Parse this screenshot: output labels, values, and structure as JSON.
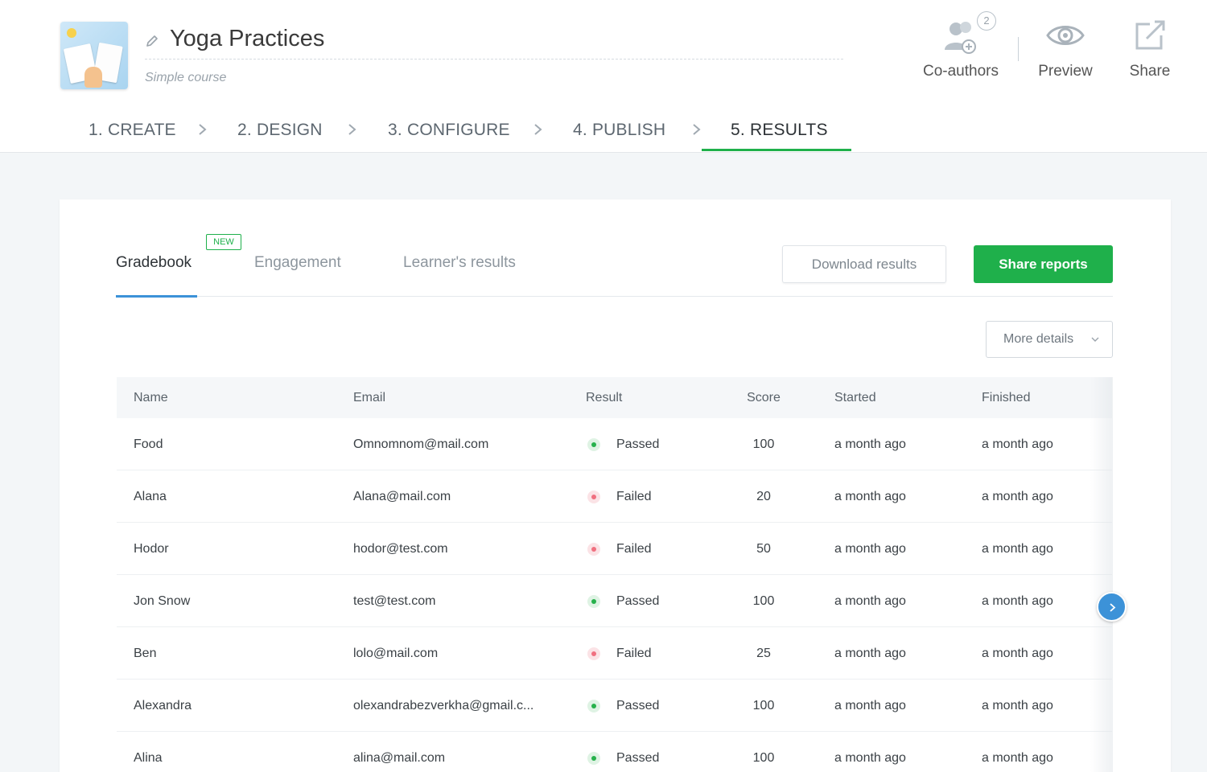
{
  "course": {
    "title": "Yoga Practices",
    "subtitle": "Simple course"
  },
  "header_actions": {
    "coauthors_label": "Co-authors",
    "coauthors_count": "2",
    "preview_label": "Preview",
    "share_label": "Share"
  },
  "steps": [
    {
      "label": "1. CREATE"
    },
    {
      "label": "2. DESIGN"
    },
    {
      "label": "3. CONFIGURE"
    },
    {
      "label": "4. PUBLISH"
    },
    {
      "label": "5. RESULTS",
      "active": true
    }
  ],
  "tabs": {
    "new_badge": "NEW",
    "items": [
      {
        "label": "Gradebook",
        "active": true
      },
      {
        "label": "Engagement"
      },
      {
        "label": "Learner's results"
      }
    ]
  },
  "buttons": {
    "download": "Download results",
    "share_reports": "Share reports",
    "more_details": "More details"
  },
  "table": {
    "columns": [
      "Name",
      "Email",
      "Result",
      "Score",
      "Started",
      "Finished"
    ],
    "rows": [
      {
        "name": "Food",
        "email": "Omnomnom@mail.com",
        "result": "Passed",
        "score": "100",
        "started": "a month ago",
        "finished": "a month ago"
      },
      {
        "name": "Alana",
        "email": "Alana@mail.com",
        "result": "Failed",
        "score": "20",
        "started": "a month ago",
        "finished": "a month ago"
      },
      {
        "name": "Hodor",
        "email": "hodor@test.com",
        "result": "Failed",
        "score": "50",
        "started": "a month ago",
        "finished": "a month ago"
      },
      {
        "name": "Jon Snow",
        "email": "test@test.com",
        "result": "Passed",
        "score": "100",
        "started": "a month ago",
        "finished": "a month ago"
      },
      {
        "name": "Ben",
        "email": "lolo@mail.com",
        "result": "Failed",
        "score": "25",
        "started": "a month ago",
        "finished": "a month ago"
      },
      {
        "name": "Alexandra",
        "email": "olexandrabezverkha@gmail.c...",
        "result": "Passed",
        "score": "100",
        "started": "a month ago",
        "finished": "a month ago"
      },
      {
        "name": "Alina",
        "email": "alina@mail.com",
        "result": "Passed",
        "score": "100",
        "started": "a month ago",
        "finished": "a month ago"
      }
    ]
  },
  "colors": {
    "accent_green": "#1fb04b",
    "accent_blue": "#3c92d8",
    "passed": "#27b14c",
    "failed": "#f07080"
  },
  "icons": {
    "edit": "pencil-icon",
    "coauthors": "users-add-icon",
    "preview": "eye-icon",
    "share": "share-icon",
    "step_separator": "chevron-right-icon",
    "more_details": "chevron-down-icon",
    "scroll": "chevron-right-icon"
  }
}
